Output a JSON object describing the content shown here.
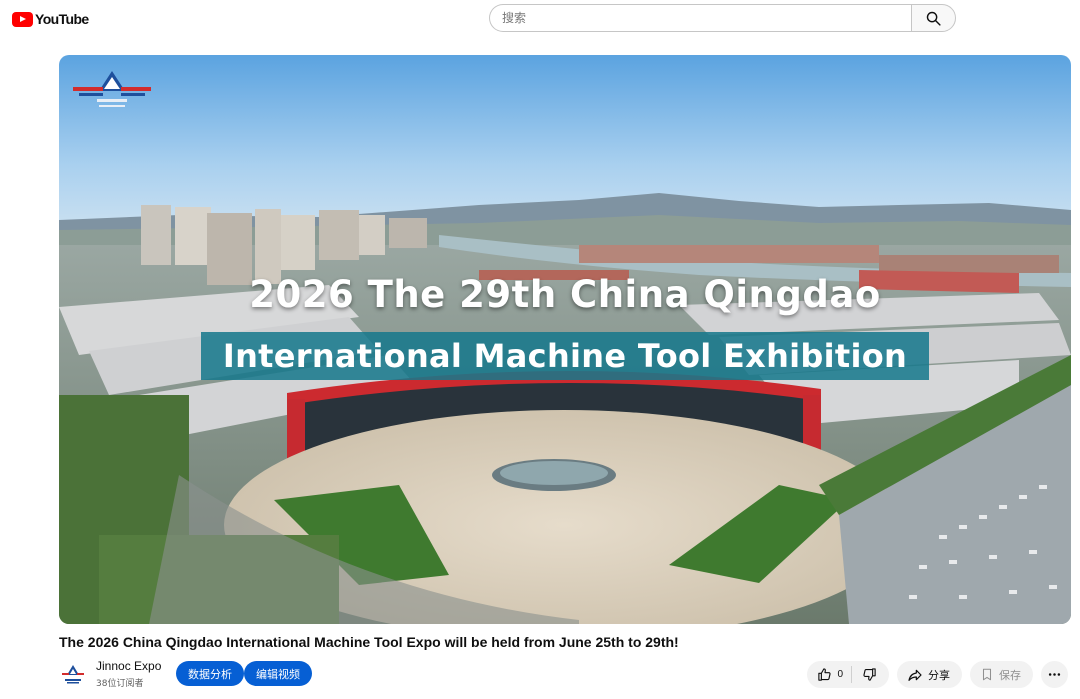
{
  "masthead": {
    "logo_text": "YouTube",
    "search": {
      "placeholder": "搜索"
    }
  },
  "player": {
    "title_line_1": "2026 The 29th China Qingdao",
    "title_line_2": "International Machine Tool Exhibition"
  },
  "watch": {
    "title": "The 2026 China Qingdao International Machine Tool Expo will be held from June 25th to 29th!",
    "channel": {
      "name": "Jinnoc Expo",
      "subscribers": "38位订阅者"
    },
    "buttons": {
      "analytics": "数据分析",
      "edit_video": "编辑视频"
    },
    "actions": {
      "like_count": "0",
      "share": "分享",
      "save": "保存"
    }
  },
  "colors": {
    "brand_red": "#ff0000",
    "primary_blue": "#065fd4",
    "pill_grey": "#f2f2f2"
  },
  "icons": [
    "youtube-logo-icon",
    "search-icon",
    "like-icon",
    "dislike-icon",
    "share-icon",
    "save-icon",
    "more-icon"
  ]
}
